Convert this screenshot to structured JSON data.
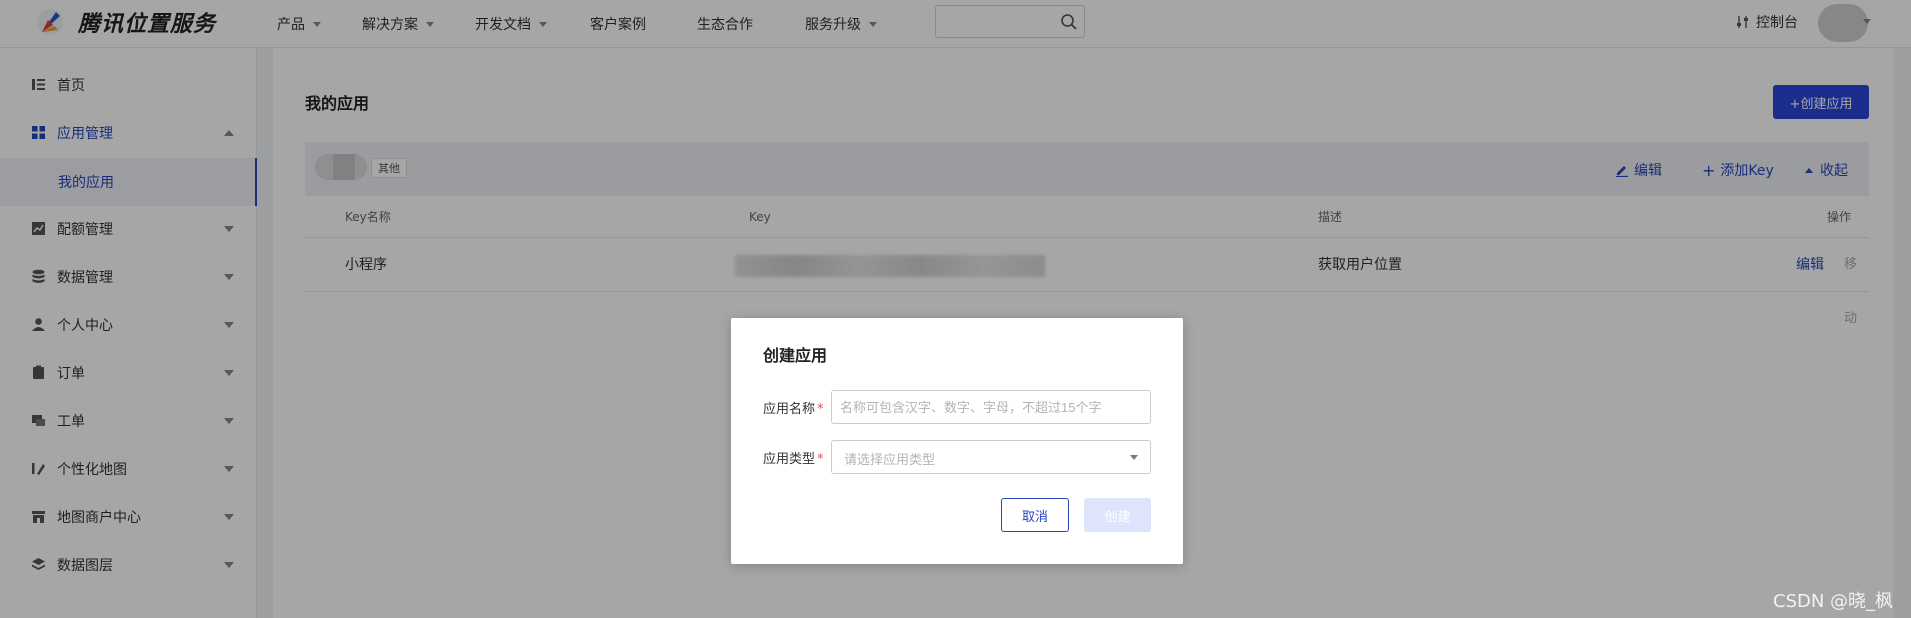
{
  "header": {
    "brand": "腾讯位置服务",
    "nav": [
      {
        "label": "产品",
        "dropdown": true
      },
      {
        "label": "解决方案",
        "dropdown": true
      },
      {
        "label": "开发文档",
        "dropdown": true
      },
      {
        "label": "客户案例",
        "dropdown": false
      },
      {
        "label": "生态合作",
        "dropdown": false
      },
      {
        "label": "服务升级",
        "dropdown": true
      }
    ],
    "search_value": "",
    "console": "控制台"
  },
  "sidebar": {
    "items": [
      {
        "label": "首页",
        "icon": "list-icon"
      },
      {
        "label": "应用管理",
        "icon": "grid-icon",
        "expanded": true
      },
      {
        "label": "配额管理",
        "icon": "chart-icon"
      },
      {
        "label": "数据管理",
        "icon": "database-icon"
      },
      {
        "label": "个人中心",
        "icon": "user-icon"
      },
      {
        "label": "订单",
        "icon": "clipboard-icon"
      },
      {
        "label": "工单",
        "icon": "ticket-icon"
      },
      {
        "label": "个性化地图",
        "icon": "map-style-icon"
      },
      {
        "label": "地图商户中心",
        "icon": "store-icon"
      },
      {
        "label": "数据图层",
        "icon": "layers-icon"
      }
    ],
    "sub_item": "我的应用"
  },
  "main": {
    "title": "我的应用",
    "create_button": "+创建应用",
    "app_tag": "其他",
    "actions": {
      "edit": "编辑",
      "add_key": "添加Key",
      "collapse": "收起"
    },
    "table": {
      "headers": [
        "Key名称",
        "Key",
        "描述",
        "操作"
      ],
      "rows": [
        {
          "name": "小程序",
          "description": "获取用户位置",
          "edit": "编辑",
          "move": "移动"
        }
      ]
    }
  },
  "modal": {
    "title": "创建应用",
    "name_label": "应用名称",
    "name_placeholder": "名称可包含汉字、数字、字母，不超过15个字",
    "type_label": "应用类型",
    "type_placeholder": "请选择应用类型",
    "cancel": "取消",
    "create": "创建"
  },
  "watermark": "CSDN @晓_枫",
  "colors": {
    "accent": "#2845b8",
    "primary_button": "#2845d8",
    "required": "#e34d59"
  }
}
